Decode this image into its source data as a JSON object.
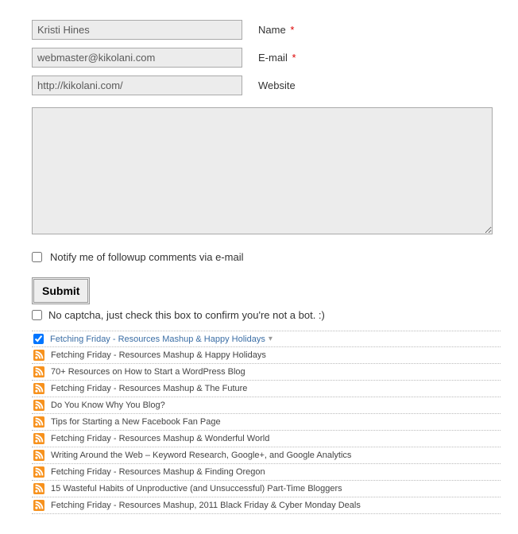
{
  "fields": {
    "name": {
      "value": "Kristi Hines",
      "label": "Name",
      "required": true
    },
    "email": {
      "value": "webmaster@kikolani.com",
      "label": "E-mail",
      "required": true
    },
    "website": {
      "value": "http://kikolani.com/",
      "label": "Website",
      "required": false
    }
  },
  "comment": {
    "value": ""
  },
  "notify": {
    "label": "Notify me of followup comments via e-mail",
    "checked": false
  },
  "submit": {
    "label": "Submit"
  },
  "captcha": {
    "label": "No captcha, just check this box to confirm you're not a bot. :)",
    "checked": false
  },
  "required_mark": "*",
  "posts": {
    "selected": {
      "title": "Fetching Friday - Resources Mashup & Happy Holidays",
      "checked": true
    },
    "items": [
      "Fetching Friday - Resources Mashup & Happy Holidays",
      "70+ Resources on How to Start a WordPress Blog",
      "Fetching Friday - Resources Mashup & The Future",
      "Do You Know Why You Blog?",
      "Tips for Starting a New Facebook Fan Page",
      "Fetching Friday - Resources Mashup & Wonderful World",
      "Writing Around the Web – Keyword Research, Google+, and Google Analytics",
      "Fetching Friday - Resources Mashup & Finding Oregon",
      "15 Wasteful Habits of Unproductive (and Unsuccessful) Part-Time Bloggers",
      "Fetching Friday - Resources Mashup, 2011 Black Friday & Cyber Monday Deals"
    ]
  }
}
